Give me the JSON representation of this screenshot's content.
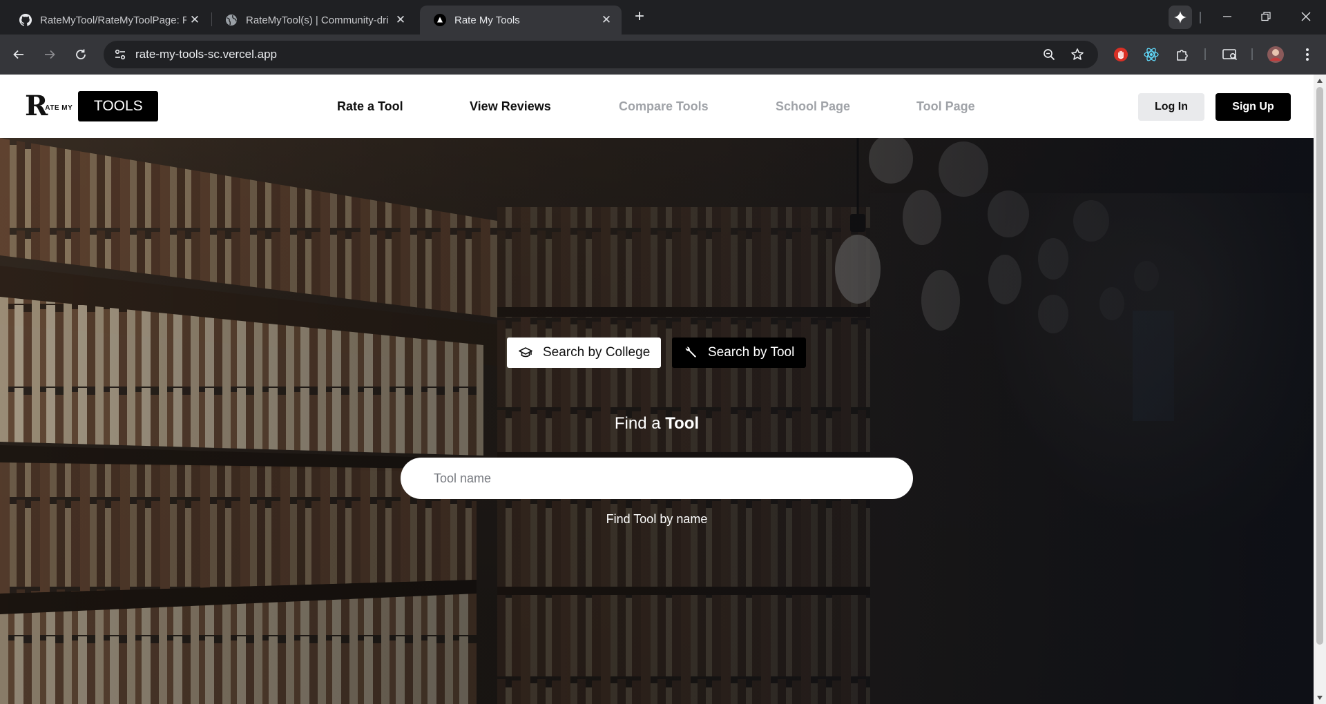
{
  "browser": {
    "tabs": [
      {
        "title": "RateMyTool/RateMyToolPage: R",
        "icon": "github-icon",
        "active": false
      },
      {
        "title": "RateMyTool(s) | Community-dri",
        "icon": "globe-icon",
        "active": false
      },
      {
        "title": "Rate My Tools",
        "icon": "vercel-triangle-icon",
        "active": true
      }
    ],
    "close_glyph": "✕",
    "new_tab_glyph": "+",
    "url": "rate-my-tools-sc.vercel.app"
  },
  "site": {
    "logo": {
      "r": "R",
      "ate_my": "ATE MY",
      "tools": "TOOLS"
    },
    "nav": {
      "rate_a_tool": "Rate a Tool",
      "view_reviews": "View Reviews",
      "compare_tools": "Compare Tools",
      "school_page": "School Page",
      "tool_page": "Tool Page"
    },
    "auth": {
      "login": "Log In",
      "signup": "Sign Up"
    }
  },
  "hero": {
    "search_by_college": "Search by College",
    "search_by_tool": "Search by Tool",
    "selected_mode": "Search by Tool",
    "find_a": "Find a",
    "find_target": "Tool",
    "input_placeholder": "Tool name",
    "input_value": "",
    "find_caption": "Find Tool by name"
  },
  "colors": {
    "nav_active": "#111111",
    "nav_inactive": "#a0a3a8",
    "primary_button": "#000000",
    "secondary_button": "#e9eaec"
  }
}
